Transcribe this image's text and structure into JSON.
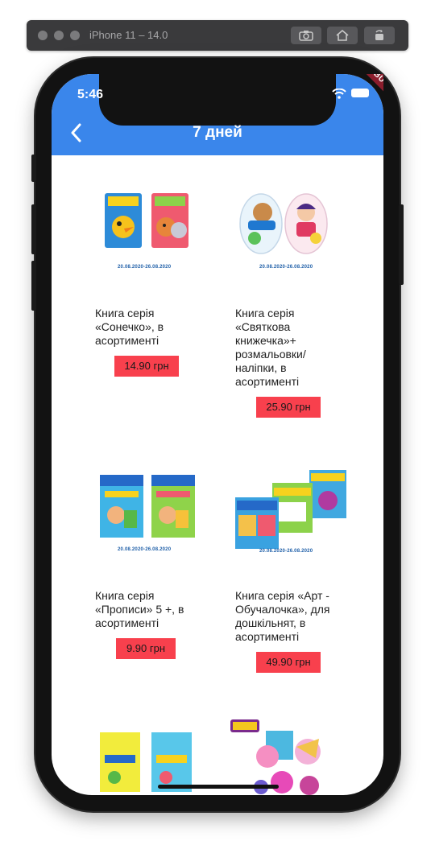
{
  "simulator": {
    "title": "iPhone 11 – 14.0"
  },
  "status_bar": {
    "time": "5:46",
    "debug_label": "DEBUG"
  },
  "app_bar": {
    "title": "7 дней",
    "back_icon": "chevron-left-icon",
    "color": "#3a86eb"
  },
  "products": [
    {
      "period": "20.08.2020-26.08.2020",
      "name": " Книга серія\n«Сонечко»,  в\nасортименті",
      "price": "14.90 грн"
    },
    {
      "period": "20.08.2020-26.08.2020",
      "name": " Книга серія\n«Святкова\nкнижечка»+\nрозмальовки/\nналіпки, в\nасортименті",
      "price": "25.90 грн"
    },
    {
      "period": "20.08.2020-26.08.2020",
      "name": " Книга серія\n«Прописи» 5 +,  в\nасортименті",
      "price": "9.90 грн"
    },
    {
      "period": "20.08.2020-26.08.2020",
      "name": " Книга серія «Арт -\nОбучалочка»,  для\nдошкільнят, в\nасортименті",
      "price": "49.90 грн"
    }
  ],
  "colors": {
    "price_badge": "#f8404d",
    "period_text": "#1f5fa8"
  }
}
